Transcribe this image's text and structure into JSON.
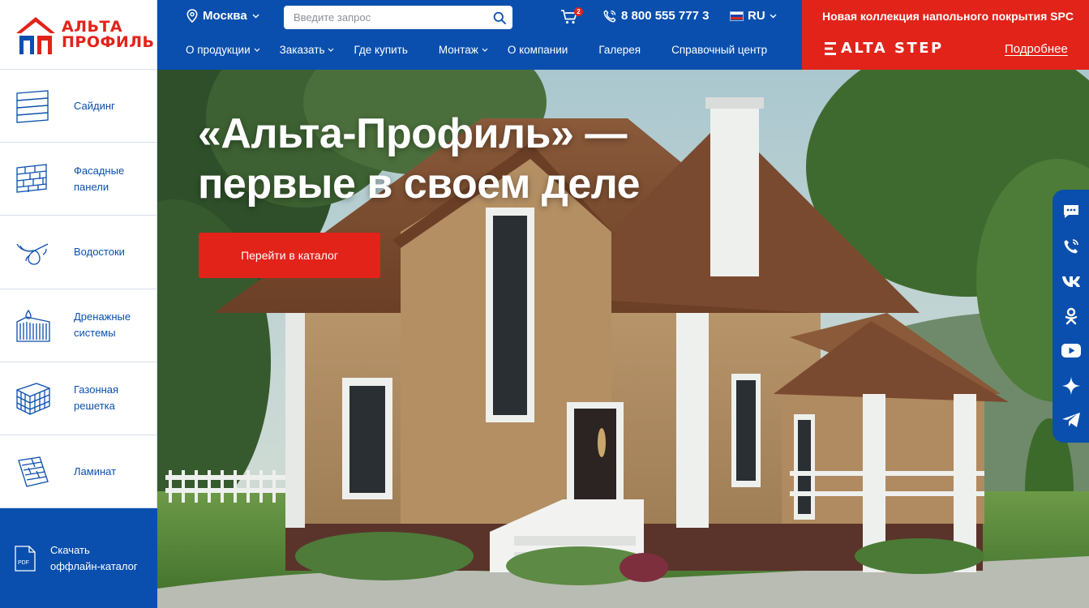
{
  "logo": {
    "line1": "АЛЬТА",
    "line2": "ПРОФИЛЬ"
  },
  "header": {
    "city": "Москва",
    "search_placeholder": "Введите запрос",
    "cart_count": "2",
    "phone": "8 800 555 777 3",
    "lang": "RU"
  },
  "nav": [
    {
      "label": "О продукции",
      "has_dropdown": true
    },
    {
      "label": "Заказать",
      "has_dropdown": true
    },
    {
      "label": "Где купить",
      "has_dropdown": false
    },
    {
      "label": "Монтаж",
      "has_dropdown": true
    },
    {
      "label": "О компании",
      "has_dropdown": false
    },
    {
      "label": "Галерея",
      "has_dropdown": false
    },
    {
      "label": "Справочный центр",
      "has_dropdown": false
    }
  ],
  "promo": {
    "title": "Новая коллекция напольного покрытия SPC",
    "brand": "ALTA STEP",
    "link": "Подробнее"
  },
  "sidebar": {
    "items": [
      {
        "label": "Сайдинг",
        "icon": "siding-icon"
      },
      {
        "label": "Фасадные\nпанели",
        "icon": "facade-panels-icon"
      },
      {
        "label": "Водостоки",
        "icon": "gutter-icon"
      },
      {
        "label": "Дренажные\nсистемы",
        "icon": "drainage-icon"
      },
      {
        "label": "Газонная\nрешетка",
        "icon": "lawn-grid-icon"
      },
      {
        "label": "Ламинат",
        "icon": "laminate-icon"
      }
    ],
    "download": "Скачать\nоффлайн-каталог",
    "download_icon_text": "PDF"
  },
  "hero": {
    "title": "«Альта-Профиль» —\nпервые в своем деле",
    "cta": "Перейти в каталог"
  },
  "social": [
    "chat-icon",
    "phone-call-icon",
    "vk-icon",
    "odnoklassniki-icon",
    "youtube-icon",
    "dzen-icon",
    "telegram-icon"
  ],
  "colors": {
    "brand_blue": "#0a4fae",
    "brand_red": "#e2231a",
    "divider": "#d7dfeb"
  }
}
